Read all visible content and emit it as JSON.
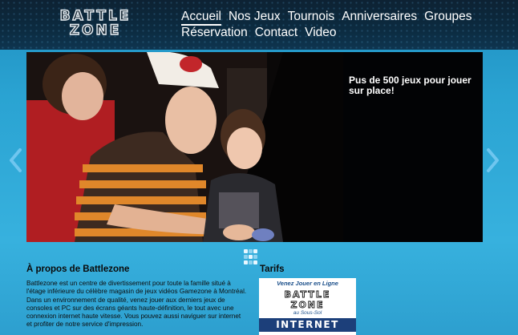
{
  "header": {
    "logo_text": "BATTLEZONE",
    "logo_line1": "BATTLE",
    "logo_line2": "ZONE"
  },
  "nav": {
    "row1": [
      {
        "label": "Accueil",
        "active": true
      },
      {
        "label": "Nos Jeux"
      },
      {
        "label": "Tournois"
      },
      {
        "label": "Anniversaires"
      },
      {
        "label": "Groupes"
      }
    ],
    "row2": [
      {
        "label": "Réservation"
      },
      {
        "label": "Contact"
      },
      {
        "label": "Video"
      }
    ]
  },
  "slider": {
    "caption": "Pus de 500 jeux pour jouer sur place!",
    "prev_icon": "chevron-left-icon",
    "next_icon": "chevron-right-icon",
    "pager_icon": "grid-dots-icon"
  },
  "about": {
    "title": "À propos de Battlezone",
    "text": "Battlezone est un centre de divertissement pour toute la famille situé à l'étage inférieure du célèbre magasin de jeux vidéos Gamezone à Montréal. Dans un environnement de qualité, venez jouer aux derniers jeux de consoles et PC sur des écrans géants haute-définition, le tout avec une connexion internet haute vitesse. Vous pouvez aussi naviguer sur internet et profiter de notre service d'impression."
  },
  "tarifs": {
    "title": "Tarifs",
    "banner_line1": "Venez Jouer en Ligne",
    "banner_brand_1": "BATTLE",
    "banner_brand_2": "ZONE",
    "banner_line2": "au Sous-Sol",
    "banner_band": "INTERNET"
  },
  "colors": {
    "page_bg": "#2aa3d2",
    "header_bg": "#0c2b40",
    "banner_band": "#1c3f7a",
    "arrow": "#6fc6ef"
  }
}
